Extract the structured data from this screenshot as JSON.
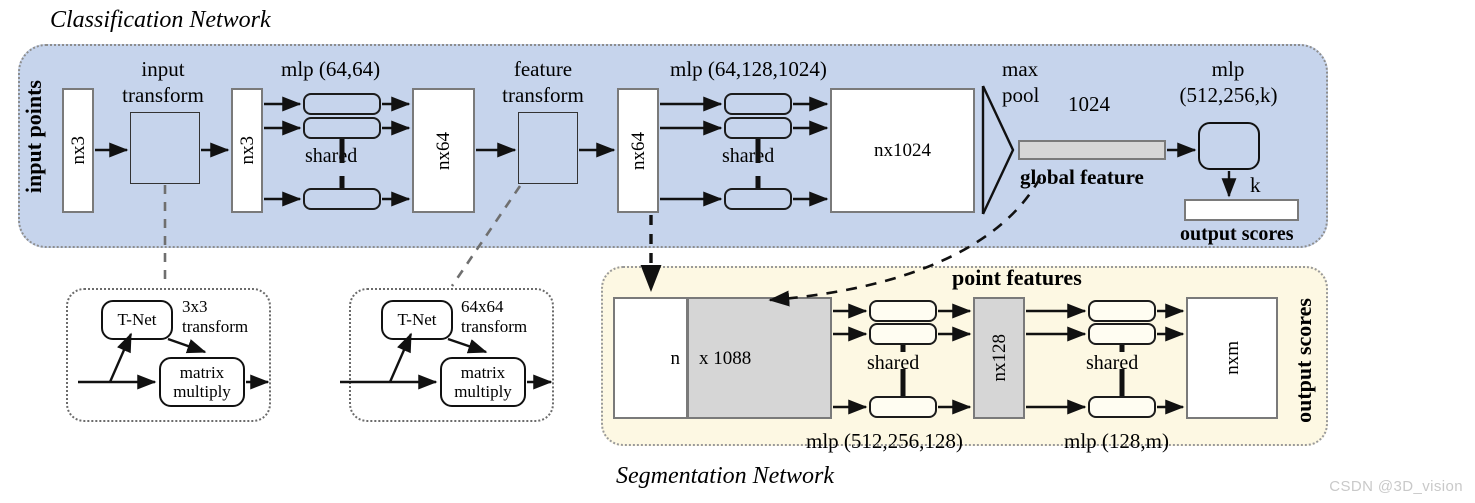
{
  "figure": {
    "watermark": "CSDN @3D_vision"
  },
  "classification": {
    "title": "Classification Network",
    "input_points_label": "input points",
    "input_tensor_1": "nx3",
    "input_transform_label_line1": "input",
    "input_transform_label_line2": "transform",
    "transformed_tensor": "nx3",
    "mlp1_label": "mlp (64,64)",
    "shared1_label": "shared",
    "nx64_a": "nx64",
    "feature_transform_label_line1": "feature",
    "feature_transform_label_line2": "transform",
    "nx64_b": "nx64",
    "mlp2_label": "mlp (64,128,1024)",
    "shared2_label": "shared",
    "nx1024": "nx1024",
    "maxpool_line1": "max",
    "maxpool_line2": "pool",
    "global_feature_dim": "1024",
    "global_feature_label": "global feature",
    "mlp3_label_line1": "mlp",
    "mlp3_label_line2": "(512,256,k)",
    "k_label": "k",
    "output_scores_label": "output scores"
  },
  "tnet_input": {
    "tnet_label": "T-Net",
    "transform_line1": "3x3",
    "transform_line2": "transform",
    "matrix_line1": "matrix",
    "matrix_line2": "multiply"
  },
  "tnet_feature": {
    "tnet_label": "T-Net",
    "transform_line1": "64x64",
    "transform_line2": "transform",
    "matrix_line1": "matrix",
    "matrix_line2": "multiply"
  },
  "segmentation": {
    "title": "Segmentation Network",
    "point_features_label": "point features",
    "concat_n": "n",
    "concat_dim": "x 1088",
    "shared1_label": "shared",
    "mlp1_label": "mlp (512,256,128)",
    "nx128": "nx128",
    "shared2_label": "shared",
    "mlp2_label": "mlp (128,m)",
    "nxm": "nxm",
    "output_scores_label": "output scores"
  },
  "colors": {
    "classification_panel": "#c6d4ec",
    "segmentation_panel": "#fdf8e3",
    "grey_tensor": "#d6d6d6",
    "stroke": "#111111",
    "watermark": "#c9c9c9"
  }
}
